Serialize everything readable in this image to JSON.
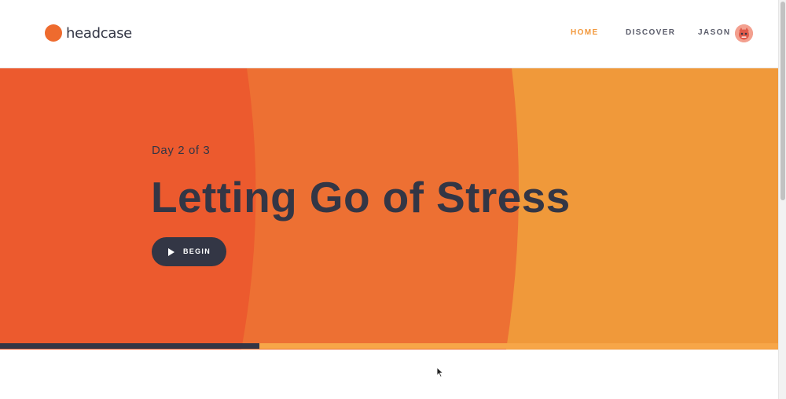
{
  "app": {
    "logo_text": "headcase"
  },
  "nav": {
    "home": "HOME",
    "discover": "DISCOVER",
    "user": "JASON"
  },
  "hero": {
    "day_label": "Day 2 of 3",
    "title": "Letting Go of Stress",
    "begin_label": "BEGIN",
    "progress_fraction": 0.333
  },
  "colors": {
    "brand": "#ee6b2e",
    "nav_active": "#f2983c",
    "text_dark": "#333645",
    "hero_left": "#ec5a2e",
    "hero_mid": "#ed7033",
    "hero_right": "#f0993a"
  },
  "icons": {
    "play": "play-icon",
    "avatar": "avatar"
  }
}
